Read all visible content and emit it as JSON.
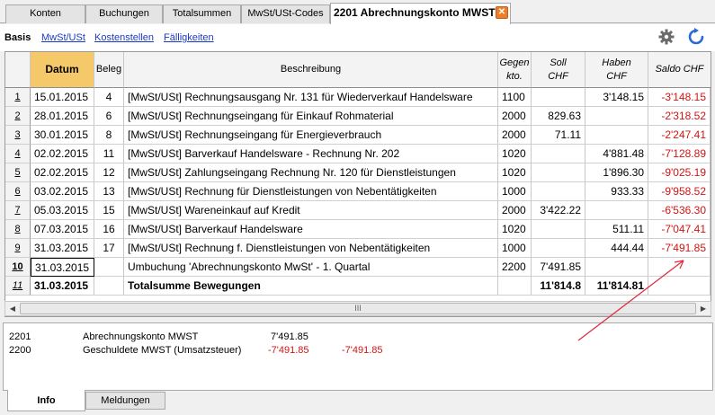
{
  "tabs": [
    {
      "label": "Konten"
    },
    {
      "label": "Buchungen"
    },
    {
      "label": "Totalsummen"
    },
    {
      "label": "MwSt/USt-Codes"
    },
    {
      "label": "2201 Abrechnungskonto MWST",
      "active": true
    }
  ],
  "views": [
    {
      "label": "Basis",
      "current": true
    },
    {
      "label": "MwSt/USt"
    },
    {
      "label": "Kostenstellen"
    },
    {
      "label": "Fälligkeiten"
    }
  ],
  "columns": {
    "datum": "Datum",
    "beleg": "Beleg",
    "beschreibung": "Beschreibung",
    "gegen_1": "Gegen",
    "gegen_2": "kto.",
    "soll_1": "Soll",
    "soll_2": "CHF",
    "haben_1": "Haben",
    "haben_2": "CHF",
    "saldo": "Saldo CHF"
  },
  "rows": [
    {
      "nr": "1",
      "datum": "15.01.2015",
      "beleg": "4",
      "beschreibung": "[MwSt/USt] Rechnungsausgang Nr. 131 für Wiederverkauf Handelsware",
      "gegenkto": "1100",
      "soll": "",
      "haben": "3'148.15",
      "saldo": "-3'148.15"
    },
    {
      "nr": "2",
      "datum": "28.01.2015",
      "beleg": "6",
      "beschreibung": "[MwSt/USt] Rechnungseingang für Einkauf Rohmaterial",
      "gegenkto": "2000",
      "soll": "829.63",
      "haben": "",
      "saldo": "-2'318.52"
    },
    {
      "nr": "3",
      "datum": "30.01.2015",
      "beleg": "8",
      "beschreibung": "[MwSt/USt] Rechnungseingang für Energieverbrauch",
      "gegenkto": "2000",
      "soll": "71.11",
      "haben": "",
      "saldo": "-2'247.41"
    },
    {
      "nr": "4",
      "datum": "02.02.2015",
      "beleg": "11",
      "beschreibung": "[MwSt/USt] Barverkauf Handelsware - Rechnung Nr. 202",
      "gegenkto": "1020",
      "soll": "",
      "haben": "4'881.48",
      "saldo": "-7'128.89"
    },
    {
      "nr": "5",
      "datum": "02.02.2015",
      "beleg": "12",
      "beschreibung": "[MwSt/USt] Zahlungseingang Rechnung Nr. 120 für Dienstleistungen",
      "gegenkto": "1020",
      "soll": "",
      "haben": "1'896.30",
      "saldo": "-9'025.19"
    },
    {
      "nr": "6",
      "datum": "03.02.2015",
      "beleg": "13",
      "beschreibung": "[MwSt/USt] Rechnung für Dienstleistungen von Nebentätigkeiten",
      "gegenkto": "1000",
      "soll": "",
      "haben": "933.33",
      "saldo": "-9'958.52"
    },
    {
      "nr": "7",
      "datum": "05.03.2015",
      "beleg": "15",
      "beschreibung": "[MwSt/USt] Wareneinkauf auf Kredit",
      "gegenkto": "2000",
      "soll": "3'422.22",
      "haben": "",
      "saldo": "-6'536.30"
    },
    {
      "nr": "8",
      "datum": "07.03.2015",
      "beleg": "16",
      "beschreibung": "[MwSt/USt] Barverkauf Handelsware",
      "gegenkto": "1020",
      "soll": "",
      "haben": "511.11",
      "saldo": "-7'047.41"
    },
    {
      "nr": "9",
      "datum": "31.03.2015",
      "beleg": "17",
      "beschreibung": "[MwSt/USt] Rechnung f. Dienstleistungen von Nebentätigkeiten",
      "gegenkto": "1000",
      "soll": "",
      "haben": "444.44",
      "saldo": "-7'491.85"
    },
    {
      "nr": "10",
      "datum": "31.03.2015",
      "beleg": "",
      "beschreibung": "Umbuchung 'Abrechnungskonto MwSt' - 1. Quartal",
      "gegenkto": "2200",
      "soll": "7'491.85",
      "haben": "",
      "saldo": ""
    }
  ],
  "total_row": {
    "nr": "11",
    "datum": "31.03.2015",
    "beschreibung": "Totalsumme Bewegungen",
    "soll": "11'814.8",
    "haben": "11'814.81"
  },
  "scrollbar": {
    "grip": "III"
  },
  "info": [
    {
      "konto": "2201",
      "name": "Abrechnungskonto MWST",
      "betrag": "7'491.85",
      "betrag2": ""
    },
    {
      "konto": "2200",
      "name": "Geschuldete MWST (Umsatzsteuer)",
      "betrag": "-7'491.85",
      "betrag2": "-7'491.85"
    }
  ],
  "bottom_tabs": [
    {
      "label": "Info",
      "active": true
    },
    {
      "label": "Meldungen"
    }
  ],
  "colors": {
    "negative": "#d21414",
    "accent_tab_close": "#ef7d2a",
    "sorted_header": "#f5c86a",
    "link": "#1a39c8",
    "annotation_arrow": "#e0283c"
  },
  "icons": {
    "settings": "gear-icon",
    "refresh": "refresh-icon",
    "close": "close-icon"
  }
}
